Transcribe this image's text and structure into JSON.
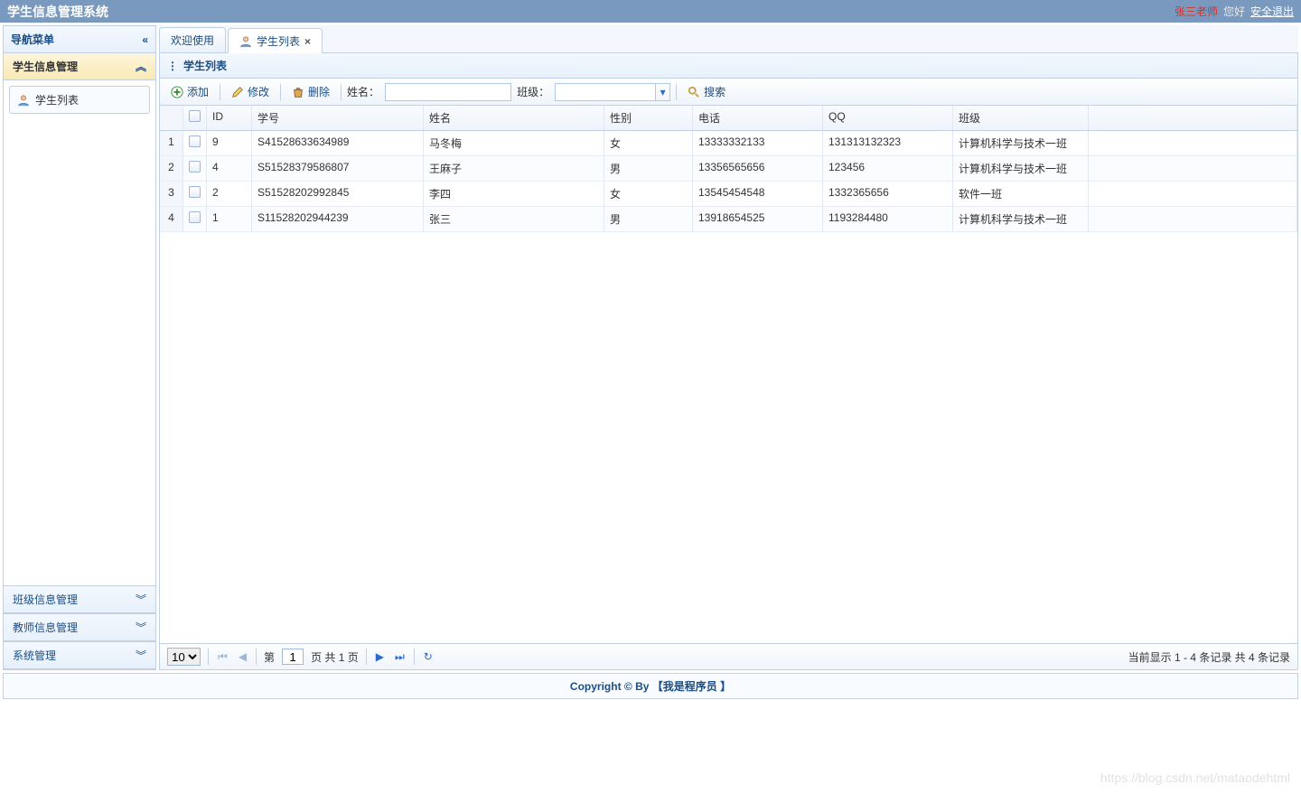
{
  "header": {
    "title": "学生信息管理系统",
    "user": "张三老师",
    "greet": "您好",
    "logout": "安全退出"
  },
  "sidebar": {
    "title": "导航菜单",
    "items": [
      {
        "label": "学生信息管理",
        "active": true
      },
      {
        "label": "班级信息管理",
        "active": false
      },
      {
        "label": "教师信息管理",
        "active": false
      },
      {
        "label": "系统管理",
        "active": false
      }
    ],
    "leaf": {
      "label": "学生列表"
    }
  },
  "tabs": {
    "items": [
      {
        "label": "欢迎使用",
        "closable": false,
        "active": false
      },
      {
        "label": "学生列表",
        "closable": true,
        "active": true
      }
    ]
  },
  "panel": {
    "title": "学生列表"
  },
  "toolbar": {
    "add": "添加",
    "edit": "修改",
    "del": "删除",
    "name_label": "姓名：",
    "name_value": "",
    "class_label": "班级：",
    "class_value": "",
    "search": "搜索"
  },
  "table": {
    "headers": {
      "rownum": "",
      "check": "",
      "id": "ID",
      "sn": "学号",
      "name": "姓名",
      "gender": "性别",
      "phone": "电话",
      "qq": "QQ",
      "klass": "班级"
    },
    "rows": [
      {
        "rn": "1",
        "id": "9",
        "sn": "S41528633634989",
        "name": "马冬梅",
        "gender": "女",
        "phone": "13333332133",
        "qq": "131313132323",
        "klass": "计算机科学与技术一班"
      },
      {
        "rn": "2",
        "id": "4",
        "sn": "S51528379586807",
        "name": "王麻子",
        "gender": "男",
        "phone": "13356565656",
        "qq": "123456",
        "klass": "计算机科学与技术一班"
      },
      {
        "rn": "3",
        "id": "2",
        "sn": "S51528202992845",
        "name": "李四",
        "gender": "女",
        "phone": "13545454548",
        "qq": "1332365656",
        "klass": "软件一班"
      },
      {
        "rn": "4",
        "id": "1",
        "sn": "S11528202944239",
        "name": "张三",
        "gender": "男",
        "phone": "13918654525",
        "qq": "1193284480",
        "klass": "计算机科学与技术一班"
      }
    ]
  },
  "pager": {
    "page_size": "10",
    "page_prefix": "第",
    "page_value": "1",
    "page_suffix": "页 共 1 页",
    "info": "当前显示 1 - 4 条记录 共 4 条记录"
  },
  "footer": {
    "label": "Copyright © By 【我是程序员 】"
  },
  "watermark": "https://blog.csdn.net/mataodehtml"
}
